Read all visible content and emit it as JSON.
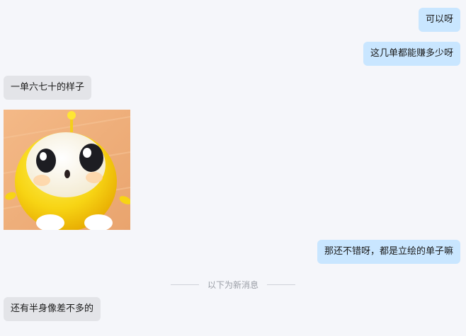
{
  "messages": [
    {
      "direction": "outgoing",
      "text": "可以呀"
    },
    {
      "direction": "outgoing",
      "text": "这几单都能赚多少呀"
    },
    {
      "direction": "incoming",
      "text": "一单六七十的样子"
    },
    {
      "direction": "incoming",
      "type": "sticker",
      "sticker_name": "yellow-round-character-sticker"
    },
    {
      "direction": "outgoing",
      "text": "那还不错呀，都是立绘的单子嘛"
    },
    {
      "direction": "incoming",
      "text": "还有半身像差不多的"
    }
  ],
  "divider": {
    "label": "以下为新消息"
  },
  "colors": {
    "background": "#f5f6fa",
    "outgoing_bubble": "#c9e6ff",
    "incoming_bubble": "#e3e4e8",
    "divider_text": "#9a9ea6"
  }
}
